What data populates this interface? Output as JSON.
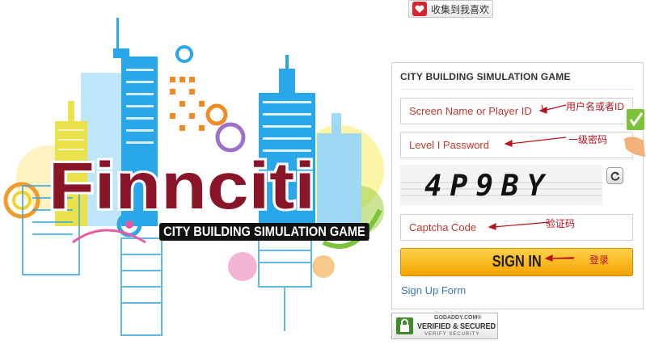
{
  "favorite": {
    "label": "收集到我喜欢"
  },
  "login": {
    "title": "CITY BUILDING SIMULATION GAME",
    "screen_name_placeholder": "Screen Name or Player ID",
    "password_placeholder": "Level I Password",
    "captcha_image_text": "4P9BY",
    "captcha_code_placeholder": "Captcha Code",
    "signin_label": "SIGN IN",
    "signup_label": "Sign Up Form"
  },
  "annotations": {
    "screen_name": "用户名或者ID",
    "password": "一级密码",
    "captcha": "验证码",
    "signin": "登录"
  },
  "logo": {
    "title": "Finnciti",
    "subtitle": "CITY BUILDING SIMULATION GAME"
  },
  "badge": {
    "line1": "GODADDY.COM®",
    "line2": "VERIFIED & SECURED",
    "line3": "VERIFY SECURITY"
  },
  "colors": {
    "accent_orange": "#f5a300",
    "annotation_red": "#b8121b",
    "link_blue": "#3a78b0",
    "building_blue": "#2aa7e8"
  }
}
